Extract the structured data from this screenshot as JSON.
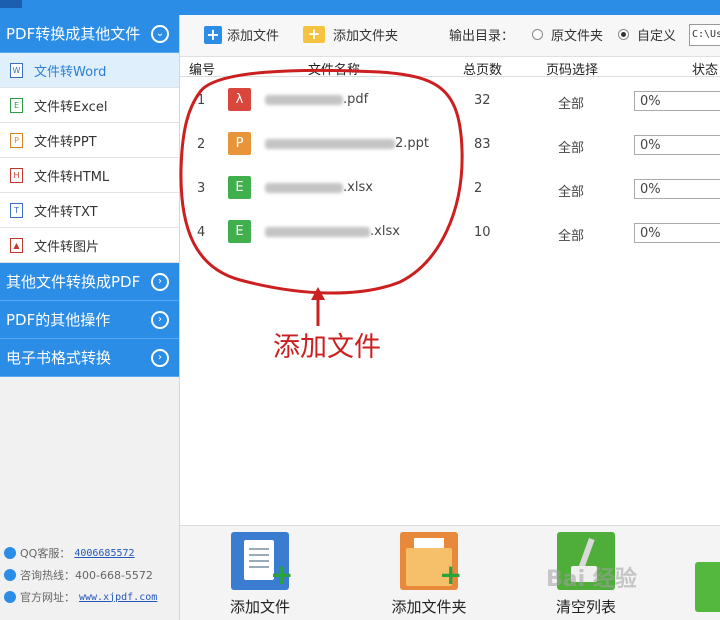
{
  "sidebar": {
    "categories": [
      {
        "label": "PDF转换成其他文件",
        "icon": "chevron-down-icon"
      },
      {
        "label": "其他文件转换成PDF",
        "icon": "chevron-right-icon"
      },
      {
        "label": "PDF的其他操作",
        "icon": "chevron-right-icon"
      },
      {
        "label": "电子书格式转换",
        "icon": "chevron-right-icon"
      }
    ],
    "items": [
      {
        "label": "文件转Word",
        "glyph": "W",
        "active": true
      },
      {
        "label": "文件转Excel",
        "glyph": "E"
      },
      {
        "label": "文件转PPT",
        "glyph": "P"
      },
      {
        "label": "文件转HTML",
        "glyph": "H"
      },
      {
        "label": "文件转TXT",
        "glyph": "T"
      },
      {
        "label": "文件转图片",
        "glyph": "▲"
      }
    ],
    "contact": {
      "qq_label": "QQ客服：",
      "qq_value": "4006685572",
      "hotline_label": "咨询热线：",
      "hotline_value": "400-668-5572",
      "site_label": "官方网址：",
      "site_value": "www.xjpdf.com"
    }
  },
  "toolbar": {
    "add_file": "添加文件",
    "add_folder": "添加文件夹",
    "output_label": "输出目录：",
    "option_original": "原文件夹",
    "option_custom": "自定义",
    "path_value": "C:\\Us"
  },
  "table": {
    "headers": [
      "编号",
      "文件名称",
      "总页数",
      "页码选择",
      "状态"
    ],
    "rows": [
      {
        "num": "1",
        "icon": "pdf",
        "name_suffix": ".pdf",
        "pages": "32",
        "range": "全部",
        "status": "0%"
      },
      {
        "num": "2",
        "icon": "P",
        "name_suffix": "2.ppt",
        "pages": "83",
        "range": "全部",
        "status": "0%"
      },
      {
        "num": "3",
        "icon": "E",
        "name_suffix": ".xlsx",
        "pages": "2",
        "range": "全部",
        "status": "0%"
      },
      {
        "num": "4",
        "icon": "E",
        "name_suffix": ".xlsx",
        "pages": "10",
        "range": "全部",
        "status": "0%"
      }
    ]
  },
  "annotation": {
    "text": "添加文件",
    "color": "#cc1f1f"
  },
  "bottom": {
    "add_file": "添加文件",
    "add_folder": "添加文件夹",
    "clear_list": "清空列表"
  },
  "watermark": "Bai 经验",
  "colors": {
    "accent": "#2b8de6",
    "pdf": "#d9463c",
    "ppt": "#e8953a",
    "xlsx": "#3fb04c"
  }
}
